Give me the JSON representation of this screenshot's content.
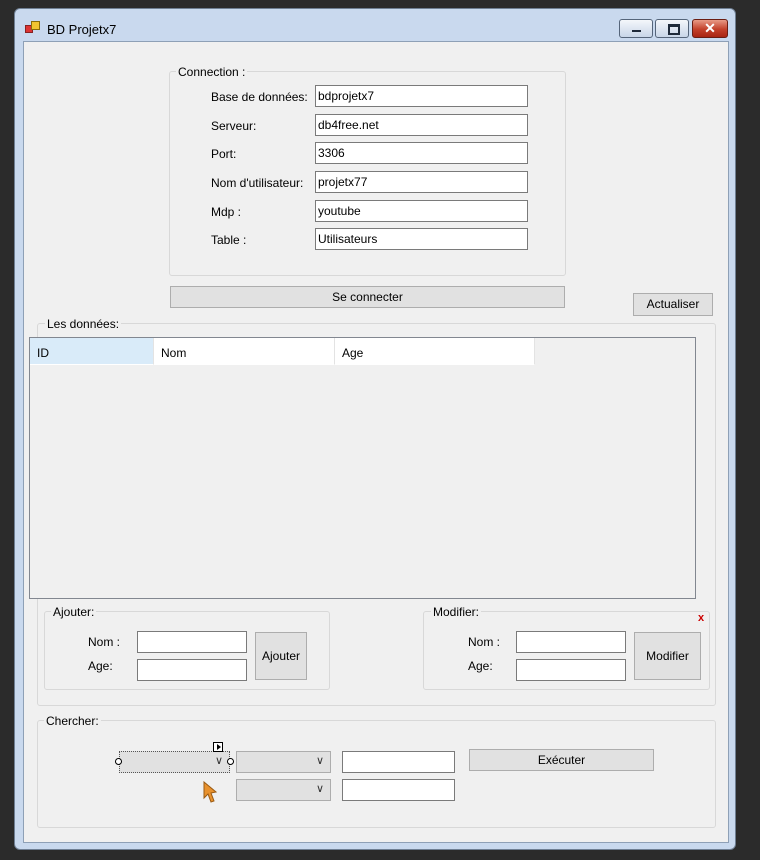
{
  "window": {
    "title": "BD Projetx7",
    "close_glyph": "✕"
  },
  "connection": {
    "caption": "Connection :",
    "fields": [
      {
        "label": "Base de données:",
        "value": "bdprojetx7"
      },
      {
        "label": "Serveur:",
        "value": "db4free.net"
      },
      {
        "label": "Port:",
        "value": "3306"
      },
      {
        "label": "Nom d'utilisateur:",
        "value": "projetx77"
      },
      {
        "label": "Mdp :",
        "value": "youtube"
      },
      {
        "label": "Table :",
        "value": "Utilisateurs"
      }
    ],
    "connect_button": "Se connecter"
  },
  "refresh_button": "Actualiser",
  "data_panel": {
    "caption": "Les données:",
    "columns": [
      "ID",
      "Nom",
      "Age"
    ]
  },
  "add_panel": {
    "caption": "Ajouter:",
    "name_label": "Nom :",
    "age_label": "Age:",
    "name_value": "",
    "age_value": "",
    "button": "Ajouter"
  },
  "edit_panel": {
    "caption": "Modifier:",
    "name_label": "Nom :",
    "age_label": "Age:",
    "name_value": "",
    "age_value": "",
    "button": "Modifier",
    "close_mark": "x"
  },
  "search_panel": {
    "caption": "Chercher:",
    "combo_arrow": "∨",
    "execute_button": "Exécuter",
    "value1": "",
    "value2": ""
  },
  "colors": {
    "close_mark": "#cc0000",
    "cursor": "#e8912d",
    "grid_selected_header": "#d9ebf9"
  },
  "icons": [
    "app-icon",
    "minimize-icon",
    "maximize-icon",
    "close-icon",
    "dropdown-arrow-icon",
    "smart-tag-icon",
    "pointer-cursor-icon"
  ]
}
